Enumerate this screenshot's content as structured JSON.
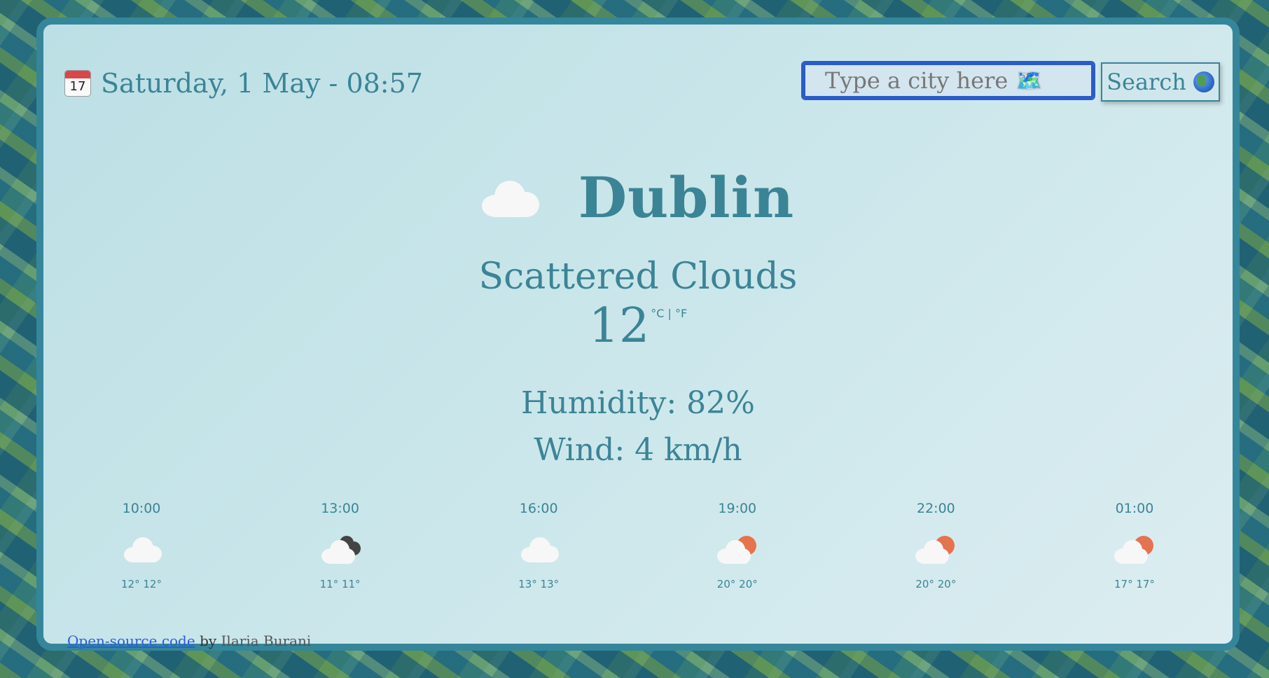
{
  "header": {
    "date_time": "Saturday, 1 May - 08:57",
    "calendar_icon": "calendar-icon",
    "calendar_day": "17",
    "search_placeholder": "Type a city here 🗺️",
    "search_label": "Search",
    "search_icon": "globe-icon"
  },
  "current": {
    "city": "Dublin",
    "icon": "cloud-icon",
    "description": "Scattered Clouds",
    "temperature": "12",
    "units": "°C | °F",
    "humidity": "Humidity: 82%",
    "wind": "Wind: 4 km/h"
  },
  "forecast": [
    {
      "time": "10:00",
      "temps": "12° 12°",
      "icon": "cloud-icon"
    },
    {
      "time": "13:00",
      "temps": "11° 11°",
      "icon": "dark-clouds-icon"
    },
    {
      "time": "16:00",
      "temps": "13° 13°",
      "icon": "cloud-icon"
    },
    {
      "time": "19:00",
      "temps": "20° 20°",
      "icon": "sun-behind-cloud-icon"
    },
    {
      "time": "22:00",
      "temps": "20° 20°",
      "icon": "sun-behind-cloud-icon"
    },
    {
      "time": "01:00",
      "temps": "17° 17°",
      "icon": "sun-behind-cloud-icon"
    }
  ],
  "footer": {
    "link_text": "Open-source code",
    "by_text": "by",
    "author": "Ilaria Burani"
  },
  "colors": {
    "accent": "#3b8496",
    "card_border": "#35869a",
    "input_border": "#2a5cc8",
    "link": "#2a5ce0",
    "sun": "#e5734f"
  }
}
